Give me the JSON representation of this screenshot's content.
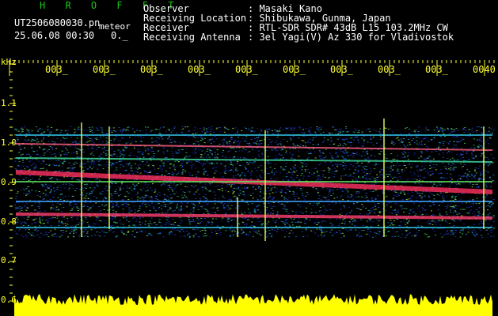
{
  "header": {
    "title": "H R O F F T",
    "filename": "UT2506080030.pn",
    "tag": "meteor",
    "datetime": "25.06.08 00:30",
    "count": "0._"
  },
  "meta": [
    {
      "key": "Observer",
      "value": ": Masaki Kano"
    },
    {
      "key": "Receiving Location",
      "value": ": Shibukawa, Gunma, Japan"
    },
    {
      "key": "Receiver",
      "value": ": RTL-SDR SDR# 43dB L15 103.2MHz CW"
    },
    {
      "key": "Receiving Antenna",
      "value": ": 3el Yagi(V) Az 330 for Vladivostok"
    }
  ],
  "axis": {
    "unit": "kHz",
    "y_ticks": [
      "1.1",
      "1.0",
      "0.9",
      "0.8",
      "0.7",
      "0.6"
    ],
    "time_ticks": [
      "003_",
      "003_",
      "003_",
      "003_",
      "003_",
      "003_",
      "003_",
      "003_",
      "003_",
      "0040"
    ]
  },
  "colors": {
    "header_green": "#17c817",
    "axis_yellow": "#ffff33",
    "background": "#000000",
    "noise_blue": "#1a2ab4",
    "signal_red": "#ff3060"
  }
}
